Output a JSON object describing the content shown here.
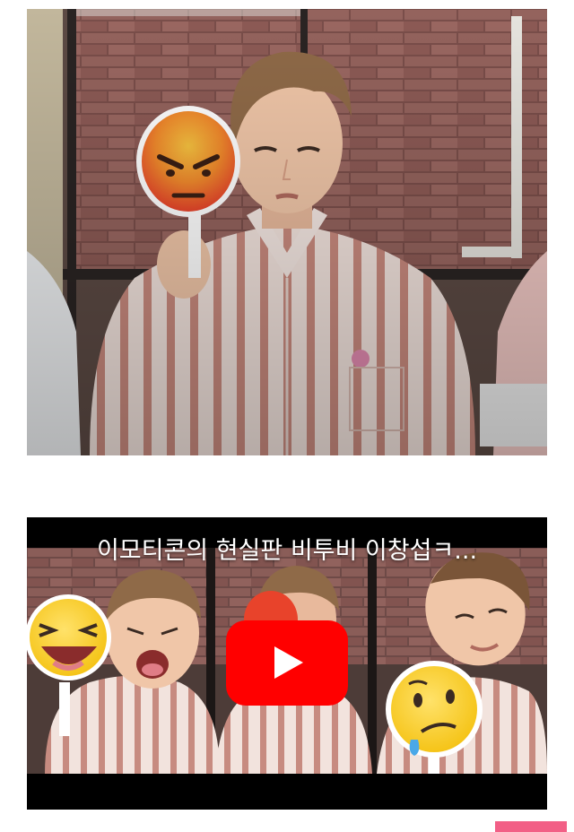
{
  "photo": {
    "alt": "man in striped shirt holding angry emoji paddle"
  },
  "video": {
    "title": "이모티콘의 현실판 비투비 이창섭ㅋ...",
    "play_icon": "play-icon"
  },
  "colors": {
    "play_button": "#ff0000",
    "accent_bar": "#f25f86",
    "brick": "#8a5a54",
    "shirt_stripe": "#c98a7e"
  }
}
